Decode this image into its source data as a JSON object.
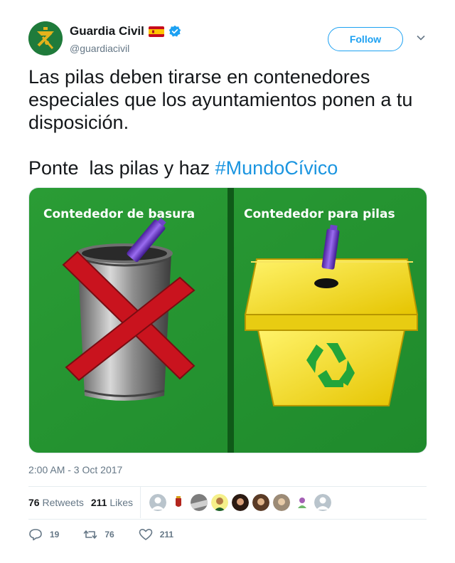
{
  "account": {
    "display_name": "Guardia Civil",
    "handle": "@guardiacivil",
    "flag_icon": "spain-flag-icon",
    "verified_icon": "verified-badge-icon",
    "follow_label": "Follow"
  },
  "tweet": {
    "line1": "Las pilas deben tirarse en contenedores especiales que los ayuntamientos ponen a tu disposición.",
    "line2_prefix": "Ponte  las pilas y haz ",
    "hashtag": "#MundoCívico"
  },
  "media": {
    "left_title": "Contededor de basura",
    "right_title": "Contededor para pilas"
  },
  "timestamp": "2:00 AM - 3 Oct 2017",
  "stats": {
    "retweets_count": "76",
    "retweets_label": "Retweets",
    "likes_count": "211",
    "likes_label": "Likes"
  },
  "actions": {
    "reply_count": "19",
    "retweet_count": "76",
    "like_count": "211"
  },
  "colors": {
    "accent": "#1da1f2",
    "hashtag": "#1b95e0",
    "muted": "#657786",
    "media_green": "#23a12e"
  }
}
